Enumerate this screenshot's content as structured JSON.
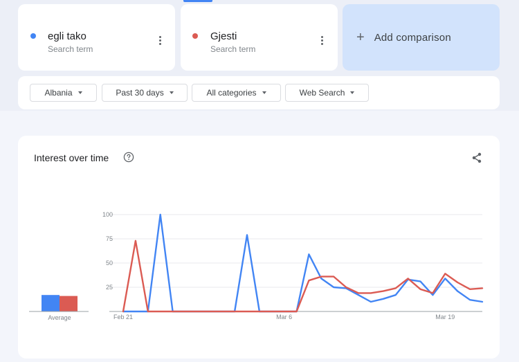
{
  "terms": [
    {
      "label": "egli tako",
      "sublabel": "Search term",
      "color": "#4285f4"
    },
    {
      "label": "Gjesti",
      "sublabel": "Search term",
      "color": "#db5b53"
    }
  ],
  "add_comparison": {
    "label": "Add comparison",
    "icon": "plus-icon"
  },
  "filters": [
    "Albania",
    "Past 30 days",
    "All categories",
    "Web Search"
  ],
  "chart": {
    "title": "Interest over time",
    "help_icon": "question-circle-icon",
    "share_icon": "share-icon",
    "average_label": "Average"
  },
  "chart_data": {
    "type": "line",
    "ylim": [
      0,
      100
    ],
    "yticks": [
      "100",
      "75",
      "50",
      "25"
    ],
    "xtick_labels": [
      "Feb 21",
      "Mar 6",
      "Mar 19"
    ],
    "grid": true,
    "x": [
      "Feb 21",
      "Feb 22",
      "Feb 23",
      "Feb 24",
      "Feb 25",
      "Feb 26",
      "Feb 27",
      "Feb 28",
      "Mar 1",
      "Mar 2",
      "Mar 3",
      "Mar 4",
      "Mar 5",
      "Mar 6",
      "Mar 7",
      "Mar 8",
      "Mar 9",
      "Mar 10",
      "Mar 11",
      "Mar 12",
      "Mar 13",
      "Mar 14",
      "Mar 15",
      "Mar 16",
      "Mar 17",
      "Mar 18",
      "Mar 19",
      "Mar 20",
      "Mar 21",
      "Mar 22"
    ],
    "series": [
      {
        "color": "#4285f4",
        "values": [
          0,
          0,
          0,
          100,
          0,
          0,
          0,
          0,
          0,
          0,
          79,
          0,
          0,
          0,
          0,
          59,
          34,
          25,
          24,
          17,
          10,
          13,
          17,
          33,
          31,
          17,
          34,
          21,
          12,
          10
        ],
        "average": 17
      },
      {
        "color": "#db5b53",
        "values": [
          0,
          73,
          0,
          0,
          0,
          0,
          0,
          0,
          0,
          0,
          0,
          0,
          0,
          0,
          0,
          32,
          36,
          36,
          25,
          19,
          19,
          21,
          24,
          34,
          23,
          19,
          39,
          30,
          23,
          24
        ],
        "average": 16
      }
    ]
  }
}
